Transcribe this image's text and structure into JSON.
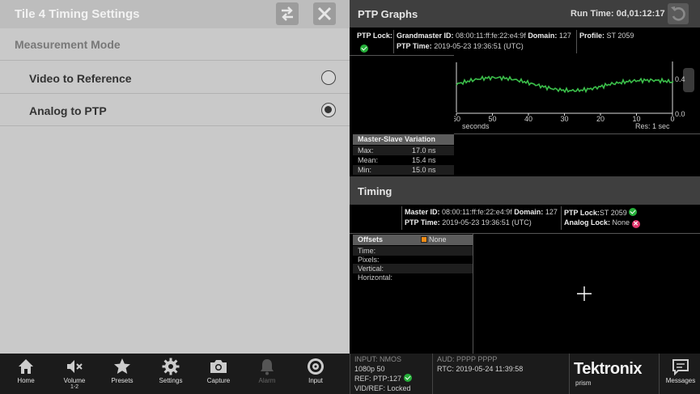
{
  "left": {
    "title": "Tile 4 Timing Settings",
    "mode_label": "Measurement Mode",
    "options": [
      {
        "label": "Video to Reference",
        "selected": false
      },
      {
        "label": "Analog to PTP",
        "selected": true
      }
    ]
  },
  "ptp": {
    "title": "PTP Graphs",
    "run_time": "Run Time: 0d,01:12:17",
    "lock_label": "PTP Lock:",
    "gm_label": "Grandmaster ID:",
    "gm_value": "08:00:11:ff:fe:22:e4:9f",
    "domain_label": "Domain:",
    "domain_value": "127",
    "time_label": "PTP Time:",
    "time_value": "2019-05-23 19:36:51 (UTC)",
    "profile_label": "Profile:",
    "profile_value": "ST 2059",
    "graph": {
      "y_top": "0.4",
      "y_bottom": "0.0",
      "x_ticks": [
        "60",
        "50",
        "40",
        "30",
        "20",
        "10",
        "0"
      ],
      "x_unit": "seconds",
      "resolution": "Res: 1 sec",
      "line_color": "#3bbf4a"
    },
    "msv": {
      "title": "Master-Slave Variation",
      "rows": [
        {
          "label": "Max:",
          "value": "17.0 ns"
        },
        {
          "label": "Mean:",
          "value": "15.4 ns"
        },
        {
          "label": "Min:",
          "value": "15.0 ns"
        }
      ]
    }
  },
  "timing": {
    "title": "Timing",
    "master_label": "Master ID:",
    "master_value": "08:00:11:ff:fe:22:e4:9f",
    "domain_label": "Domain:",
    "domain_value": "127",
    "time_label": "PTP Time:",
    "time_value": "2019-05-23 19:36:51 (UTC)",
    "lock_label": "PTP Lock:",
    "lock_value": "ST 2059",
    "analog_label": "Analog Lock:",
    "analog_value": "None",
    "offsets": {
      "title": "Offsets",
      "source": "None",
      "rows": [
        "Time:",
        "Pixels:",
        "Vertical:",
        "Horizontal:"
      ]
    }
  },
  "nav": [
    {
      "label": "Home",
      "icon": "home-icon"
    },
    {
      "label": "Volume",
      "sub": "1-2",
      "icon": "volume-muted-icon"
    },
    {
      "label": "Presets",
      "icon": "star-icon"
    },
    {
      "label": "Settings",
      "icon": "gear-icon"
    },
    {
      "label": "Capture",
      "icon": "camera-icon"
    },
    {
      "label": "Alarm",
      "icon": "bell-icon"
    },
    {
      "label": "Input",
      "icon": "input-icon"
    }
  ],
  "status": {
    "input": "INPUT: NMOS",
    "format": "1080p 50",
    "ref": "REF: PTP:127",
    "vidref": "VID/REF: Locked",
    "aud": "AUD: PPPP PPPP",
    "rtc": "RTC: 2019-05-24 11:39:58"
  },
  "brand": {
    "name": "Tektronix",
    "sub": "prism"
  },
  "messages_label": "Messages"
}
